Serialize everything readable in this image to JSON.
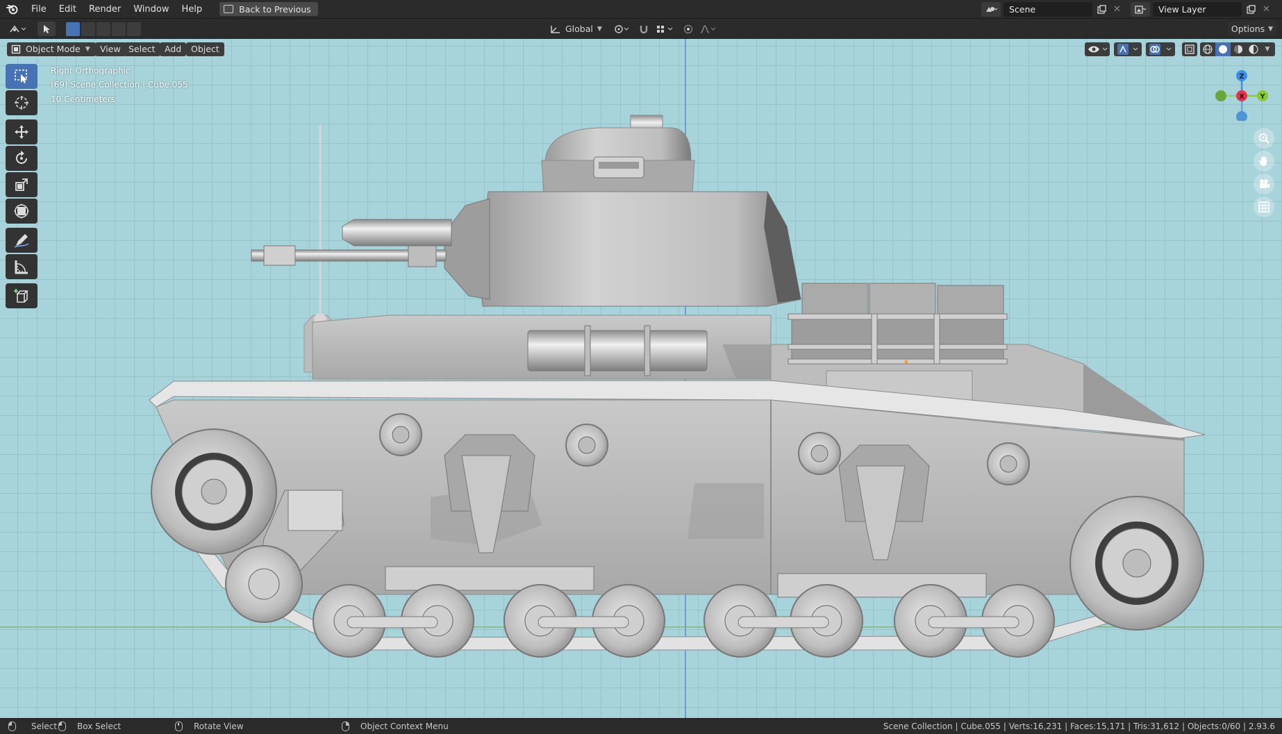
{
  "menu": {
    "items": [
      "File",
      "Edit",
      "Render",
      "Window",
      "Help"
    ],
    "back_button": "Back to Previous"
  },
  "scene": {
    "label": "Scene",
    "view_layer": "View Layer"
  },
  "tool_header": {
    "orientation": "Global",
    "options_label": "Options"
  },
  "viewport_header": {
    "mode": "Object Mode",
    "menus": [
      "View",
      "Select",
      "Add",
      "Object"
    ]
  },
  "overlay": {
    "view_name": "Right Orthographic",
    "collection": "(69) Scene Collection | Cube.055",
    "grid_scale": "10 Centimeters"
  },
  "gizmo": {
    "z": "Z",
    "x": "X",
    "y": "Y"
  },
  "toolbar": {
    "tools": [
      "select-box-tool",
      "cursor-tool",
      "move-tool",
      "rotate-tool",
      "scale-tool",
      "transform-tool",
      "annotate-tool",
      "measure-tool",
      "add-cube-tool"
    ],
    "active": "select-box-tool"
  },
  "status": {
    "select": "Select",
    "box_select": "Box Select",
    "rotate_view": "Rotate View",
    "context_menu": "Object Context Menu",
    "stats": "Scene Collection | Cube.055 | Verts:16,231 | Faces:15,171 | Tris:31,612 | Objects:0/60 | 2.93.6"
  },
  "colors": {
    "viewport_bg": "#a7d3da",
    "grid_line": "#96c3ca",
    "active_tool": "#4772b3",
    "axis_x": "#e0344f",
    "axis_y": "#8bc932",
    "axis_z": "#3a8ee6",
    "model": "#b8b8b8"
  }
}
